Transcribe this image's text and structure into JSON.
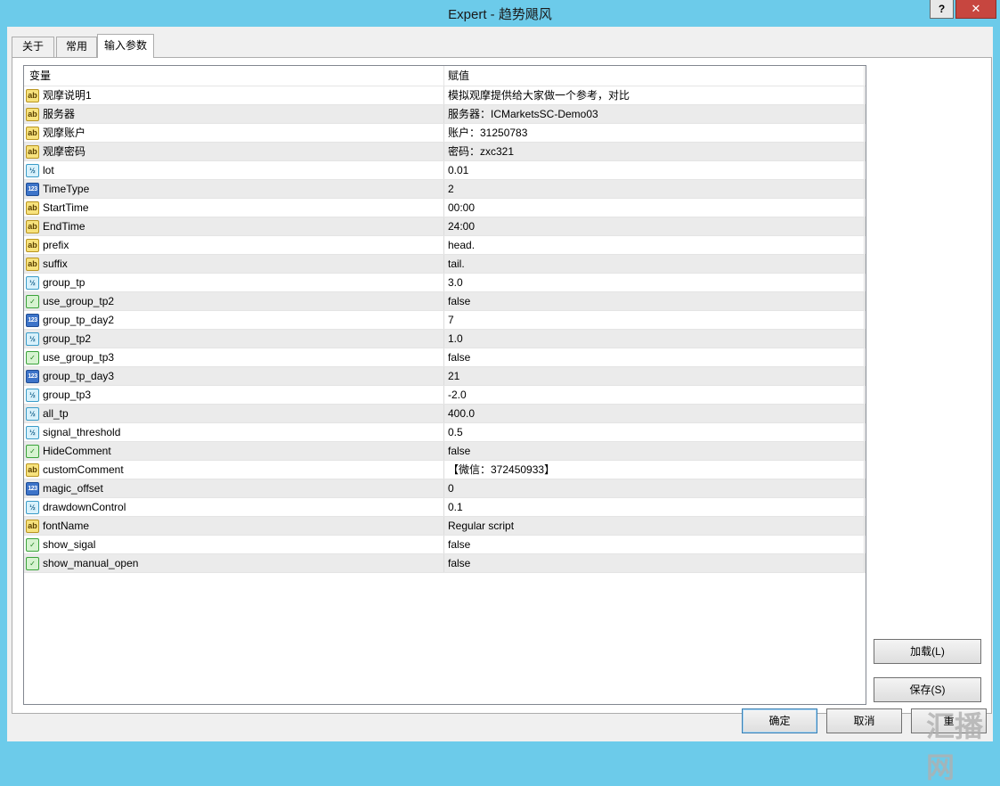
{
  "window": {
    "title": "Expert - 趋势飓风",
    "help_label": "?",
    "close_label": "✕"
  },
  "tabs": [
    {
      "label": "关于"
    },
    {
      "label": "常用"
    },
    {
      "label": "输入参数"
    }
  ],
  "grid": {
    "columns": [
      "变量",
      "赋值"
    ],
    "rows": [
      {
        "name": "观摩说明1",
        "value": "模拟观摩提供给大家做一个参考，对比",
        "type": "string",
        "icon": "ab"
      },
      {
        "name": "服务器",
        "value": "服务器：ICMarketsSC-Demo03",
        "type": "string",
        "icon": "ab"
      },
      {
        "name": "观摩账户",
        "value": "账户：31250783",
        "type": "string",
        "icon": "ab"
      },
      {
        "name": "观摩密码",
        "value": "密码：zxc321",
        "type": "string",
        "icon": "ab"
      },
      {
        "name": "lot",
        "value": "0.01",
        "type": "double",
        "icon": "½"
      },
      {
        "name": "TimeType",
        "value": "2",
        "type": "int",
        "icon": "123"
      },
      {
        "name": "StartTime",
        "value": "00:00",
        "type": "string",
        "icon": "ab"
      },
      {
        "name": "EndTime",
        "value": "24:00",
        "type": "string",
        "icon": "ab"
      },
      {
        "name": "prefix",
        "value": "head.",
        "type": "string",
        "icon": "ab"
      },
      {
        "name": "suffix",
        "value": "tail.",
        "type": "string",
        "icon": "ab"
      },
      {
        "name": "group_tp",
        "value": "3.0",
        "type": "double",
        "icon": "½"
      },
      {
        "name": "use_group_tp2",
        "value": "false",
        "type": "bool",
        "icon": "✓"
      },
      {
        "name": "group_tp_day2",
        "value": "7",
        "type": "int",
        "icon": "123"
      },
      {
        "name": "group_tp2",
        "value": "1.0",
        "type": "double",
        "icon": "½"
      },
      {
        "name": "use_group_tp3",
        "value": "false",
        "type": "bool",
        "icon": "✓"
      },
      {
        "name": "group_tp_day3",
        "value": "21",
        "type": "int",
        "icon": "123"
      },
      {
        "name": "group_tp3",
        "value": "-2.0",
        "type": "double",
        "icon": "½"
      },
      {
        "name": "all_tp",
        "value": "400.0",
        "type": "double",
        "icon": "½"
      },
      {
        "name": "signal_threshold",
        "value": "0.5",
        "type": "double",
        "icon": "½"
      },
      {
        "name": "HideComment",
        "value": "false",
        "type": "bool",
        "icon": "✓"
      },
      {
        "name": "customComment",
        "value": "【微信：372450933】",
        "type": "string",
        "icon": "ab"
      },
      {
        "name": "magic_offset",
        "value": "0",
        "type": "int",
        "icon": "123"
      },
      {
        "name": "drawdownControl",
        "value": "0.1",
        "type": "double",
        "icon": "½"
      },
      {
        "name": "fontName",
        "value": "Regular script",
        "type": "string",
        "icon": "ab"
      },
      {
        "name": "show_sigal",
        "value": "false",
        "type": "bool",
        "icon": "✓"
      },
      {
        "name": "show_manual_open",
        "value": "false",
        "type": "bool",
        "icon": "✓"
      }
    ]
  },
  "buttons": {
    "load": "加载(L)",
    "save": "保存(S)",
    "ok": "确定",
    "cancel": "取消",
    "reset": "重"
  },
  "watermark": "汇播网"
}
